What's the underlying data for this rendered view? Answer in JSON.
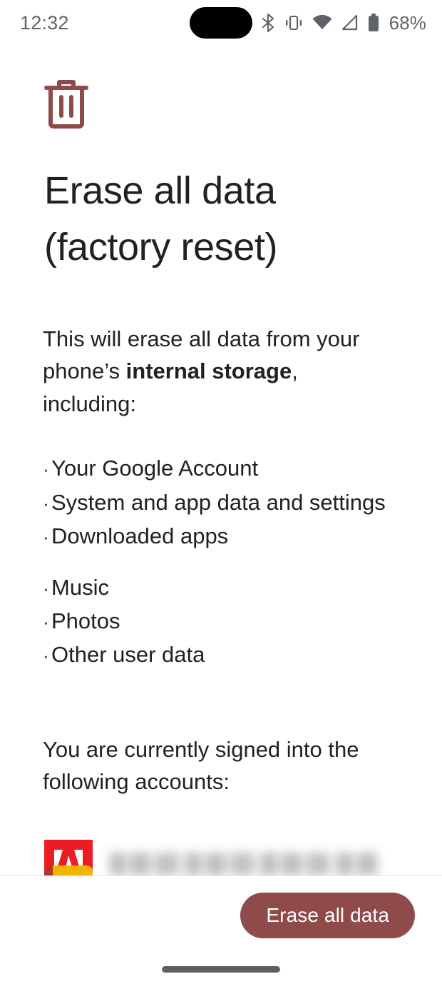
{
  "status_bar": {
    "time": "12:32",
    "battery_percent": "68%",
    "icons": [
      "bluetooth-icon",
      "vibrate-icon",
      "wifi-icon",
      "cellular-signal-icon",
      "battery-icon"
    ],
    "text_color": "#5f6368"
  },
  "screen": {
    "hero_icon": "trash-icon",
    "hero_icon_color": "#8f4a4a",
    "title": "Erase all data (factory reset)",
    "intro": {
      "before_bold": "This will erase all data from your phone’s ",
      "bold": "internal storage",
      "after_bold": ", including:"
    },
    "bullet_groups": [
      {
        "items": [
          "Your Google Account",
          "System and app data and settings",
          "Downloaded apps"
        ]
      },
      {
        "items": [
          "Music",
          "Photos",
          "Other user data"
        ]
      }
    ],
    "bullet_char": "·",
    "accounts_intro": "You are currently signed into the following accounts:",
    "accounts": [
      {
        "logo": "adobe-logo",
        "logo_color": "#ED1C24",
        "email": "",
        "email_redacted": true
      }
    ],
    "partial_account_logo_color": "#F4B400"
  },
  "bottom_bar": {
    "erase_button_label": "Erase all data",
    "erase_button_color": "#8f4a4a",
    "erase_button_text_color": "#ffffff"
  },
  "navigation": {
    "home_indicator_color": "#5f5f5f"
  }
}
